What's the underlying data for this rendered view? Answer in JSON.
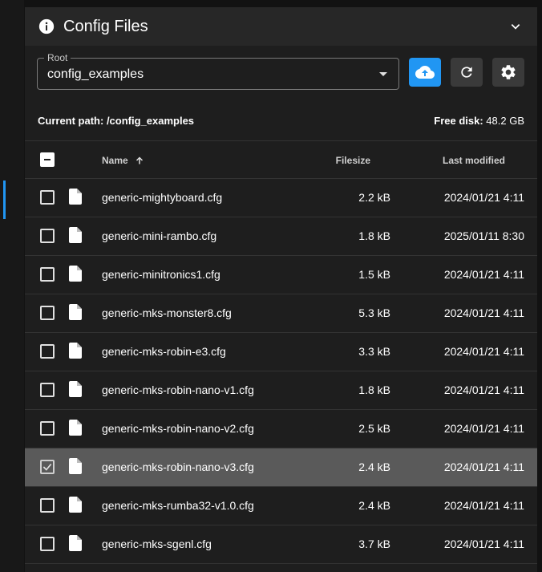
{
  "panel": {
    "title": "Config Files"
  },
  "root_select": {
    "label": "Root",
    "value": "config_examples"
  },
  "info": {
    "path_text": "Current path: /config_examples",
    "disk_label": "Free disk:",
    "disk_value": "48.2 GB"
  },
  "table": {
    "headers": {
      "name": "Name",
      "size": "Filesize",
      "modified": "Last modified"
    },
    "rows": [
      {
        "name": "generic-mightyboard.cfg",
        "size": "2.2 kB",
        "modified": "2024/01/21 4:11",
        "selected": false
      },
      {
        "name": "generic-mini-rambo.cfg",
        "size": "1.8 kB",
        "modified": "2025/01/11 8:30",
        "selected": false
      },
      {
        "name": "generic-minitronics1.cfg",
        "size": "1.5 kB",
        "modified": "2024/01/21 4:11",
        "selected": false
      },
      {
        "name": "generic-mks-monster8.cfg",
        "size": "5.3 kB",
        "modified": "2024/01/21 4:11",
        "selected": false
      },
      {
        "name": "generic-mks-robin-e3.cfg",
        "size": "3.3 kB",
        "modified": "2024/01/21 4:11",
        "selected": false
      },
      {
        "name": "generic-mks-robin-nano-v1.cfg",
        "size": "1.8 kB",
        "modified": "2024/01/21 4:11",
        "selected": false
      },
      {
        "name": "generic-mks-robin-nano-v2.cfg",
        "size": "2.5 kB",
        "modified": "2024/01/21 4:11",
        "selected": false
      },
      {
        "name": "generic-mks-robin-nano-v3.cfg",
        "size": "2.4 kB",
        "modified": "2024/01/21 4:11",
        "selected": true
      },
      {
        "name": "generic-mks-rumba32-v1.0.cfg",
        "size": "2.4 kB",
        "modified": "2024/01/21 4:11",
        "selected": false
      },
      {
        "name": "generic-mks-sgenl.cfg",
        "size": "3.7 kB",
        "modified": "2024/01/21 4:11",
        "selected": false
      }
    ]
  },
  "colors": {
    "accent": "#2196f3",
    "background": "#1e1e1e",
    "header": "#272727",
    "selected_row": "#5a5a5a"
  },
  "icons": {
    "header": "info-icon",
    "collapse": "chevron-down-icon",
    "upload": "cloud-upload-icon",
    "refresh": "refresh-icon",
    "settings": "gear-icon",
    "file": "file-icon",
    "sort": "arrow-up-icon"
  }
}
